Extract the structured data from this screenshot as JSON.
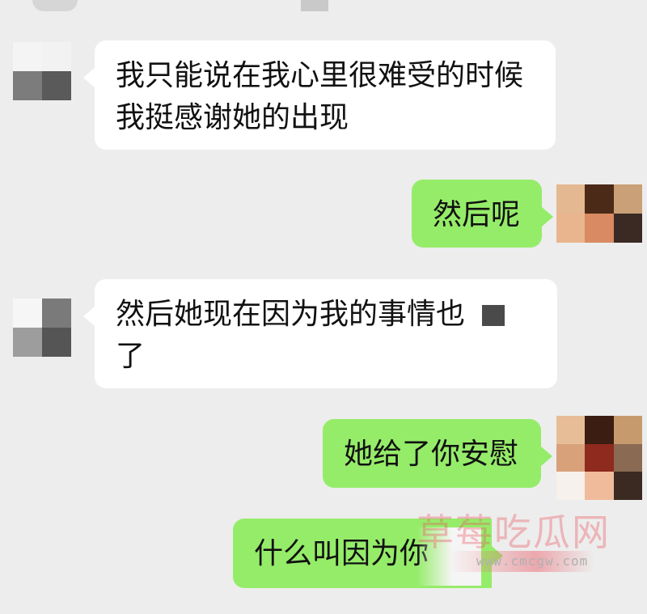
{
  "messages": [
    {
      "side": "in",
      "lines": [
        "我只能说在我心里很难受的时候",
        "我挺感谢她的出现"
      ]
    },
    {
      "side": "out",
      "lines": [
        "然后呢"
      ]
    },
    {
      "side": "in",
      "lines": [
        "然后她现在因为我的事情也",
        "了"
      ]
    },
    {
      "side": "out",
      "lines": [
        "她给了你安慰"
      ]
    },
    {
      "side": "out",
      "lines": [
        "什么叫因为你"
      ]
    }
  ],
  "watermark": {
    "brand": "草莓吃瓜网",
    "url": "www.cmcgw.com"
  },
  "avatars": {
    "contact": {
      "name": "contact-avatar",
      "colors": [
        "#ffffff",
        "#efefef",
        "#f2f2f2",
        "#7a7a7a",
        "#5e5e5e",
        "#f5f5f5",
        "#ececec",
        "#9b9b9b",
        "#4f4f4f"
      ]
    },
    "self": {
      "name": "self-avatar",
      "colors": [
        "#e2b58f",
        "#4a2b1a",
        "#c99a6b",
        "#e7b58e",
        "#d9875f",
        "#3d2a22",
        "#f6c49e",
        "#c5835b",
        "#5a4638"
      ]
    }
  }
}
